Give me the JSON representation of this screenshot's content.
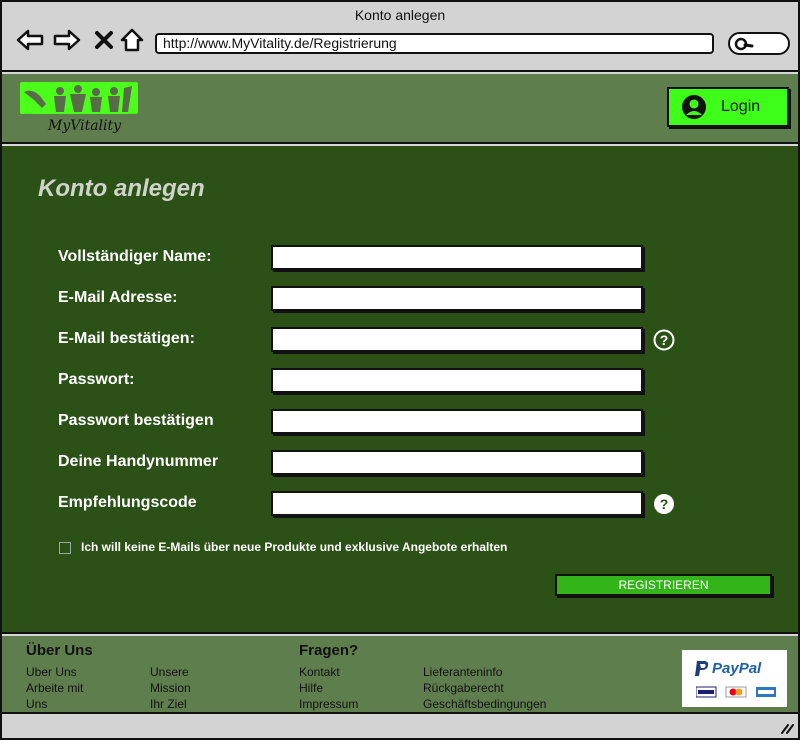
{
  "browser": {
    "title": "Konto anlegen",
    "url": "http://www.MyVitality.de/Registrierung"
  },
  "header": {
    "logo_text": "MyVitality",
    "login_label": "Login",
    "accent_color": "#3dff1a"
  },
  "form": {
    "title": "Konto anlegen",
    "fields": [
      {
        "label": "Vollständiger Name:",
        "value": ""
      },
      {
        "label": "E-Mail Adresse:",
        "value": ""
      },
      {
        "label": "E-Mail bestätigen:",
        "value": ""
      },
      {
        "label": "Passwort:",
        "value": ""
      },
      {
        "label": "Passwort bestätigen",
        "value": ""
      },
      {
        "label": "Deine Handynummer",
        "value": ""
      },
      {
        "label": "Empfehlungscode",
        "value": ""
      }
    ],
    "newsletter_optout_label": "Ich will keine E-Mails über neue Produkte und exklusive Angebote erhalten",
    "newsletter_optout_checked": false,
    "register_label": "REGISTRIEREN",
    "background_color": "#2b5117"
  },
  "footer": {
    "col1_heading": "Über Uns",
    "col1_links": [
      "Uber Uns",
      "Arbeite mit",
      "Uns"
    ],
    "col2_links": [
      "Unsere",
      "Mission",
      "Ihr Ziel"
    ],
    "col3_heading": "Fragen?",
    "col3_links": [
      "Kontakt",
      "Hilfe",
      "Impressum"
    ],
    "col4_links": [
      "Lieferanteninfo",
      "Rückgaberecht",
      "Geschäftsbedingungen"
    ],
    "payment": "PayPal"
  }
}
